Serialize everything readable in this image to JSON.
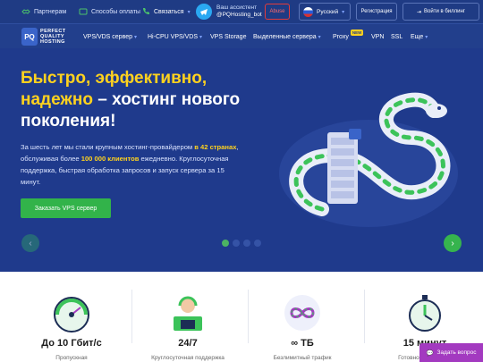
{
  "topbar": {
    "partners": "Партнерам",
    "payment": "Способы оплаты",
    "contact": "Связаться",
    "assistant_label": "Ваш ассистент",
    "assistant_handle": "@PQHosting_bot",
    "abuse": "Abuse",
    "language": "Русский",
    "register": "Регистрация",
    "login": "Войти в биллинг"
  },
  "logo": {
    "mark": "PQ",
    "line1": "PERFECT",
    "line2": "QUALITY",
    "line3": "HOSTING"
  },
  "nav": {
    "items": [
      "VPS/VDS сервер",
      "Hi-CPU VPS/VDS",
      "VPS Storage",
      "Выделенные сервера",
      "Proxy",
      "VPN",
      "SSL",
      "Еще"
    ],
    "new_badge": "NEW"
  },
  "hero": {
    "title_y1": "Быстро, эффективно,",
    "title_y2": "надежно",
    "title_rest": " – хостинг нового поколения!",
    "desc_1": "За шесть лет мы стали крупным хостинг-провайдером ",
    "desc_countries": "в 42 странах",
    "desc_2": ", обслуживая более ",
    "desc_clients": "100 000 клиентов",
    "desc_3": " ежедневно. Круглосуточная поддержка, быстрая обработка запросов и запуск сервера за 15 минут.",
    "button": "Заказать VPS сервер",
    "slides_active": 0
  },
  "features": [
    {
      "title": "До 10 Гбит/с",
      "sub": "Пропускная"
    },
    {
      "title": "24/7",
      "sub": "Круглосуточная поддержка"
    },
    {
      "title": "∞ ТБ",
      "sub": "Безлимитный трафик"
    },
    {
      "title": "15 минут",
      "sub": "Готовность сервера"
    }
  ],
  "ask": "Задать вопрос",
  "colors": {
    "brand": "#1f3a8c",
    "accent": "#ffd21e",
    "green": "#32b34a",
    "ask": "#a33ac0"
  }
}
